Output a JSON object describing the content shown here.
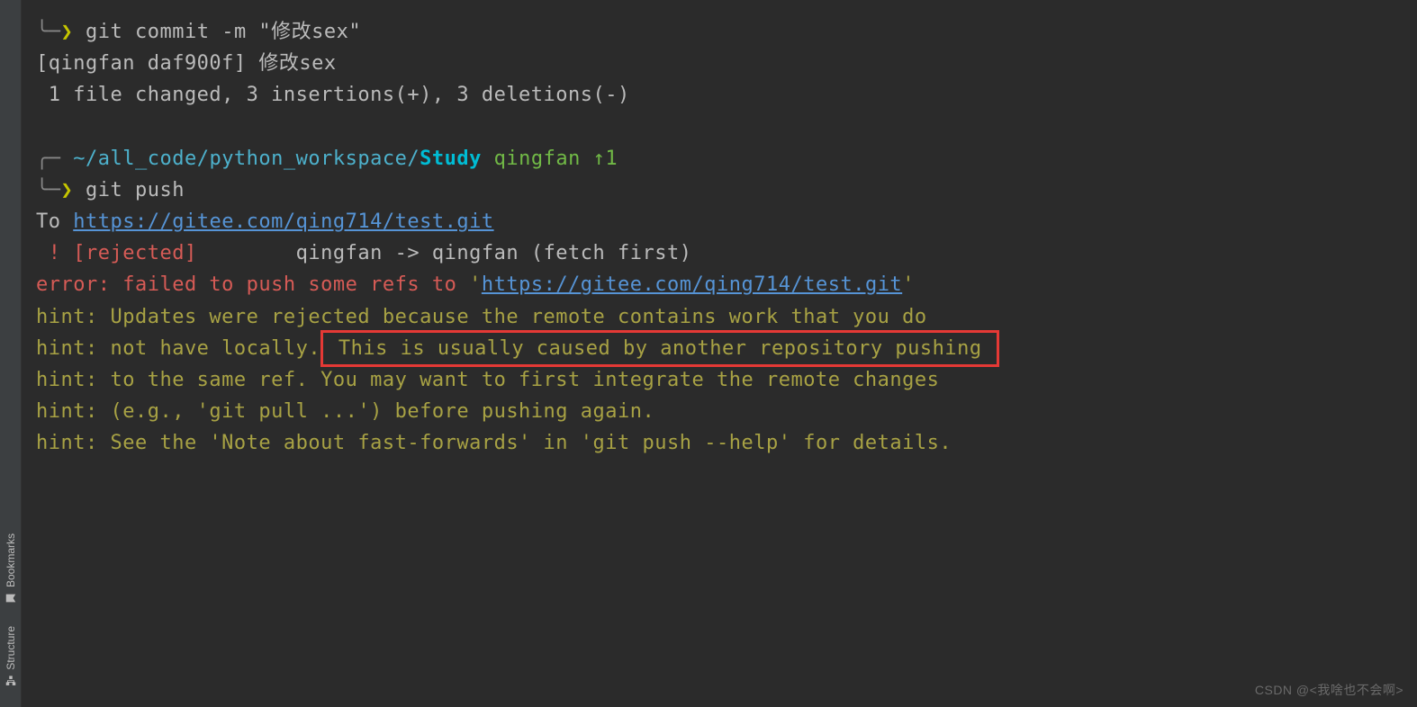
{
  "sidebar": {
    "tabs": [
      {
        "label": "Bookmarks"
      },
      {
        "label": "Structure"
      }
    ]
  },
  "terminal": {
    "line1_cmd": "git commit -m \"修改sex\"",
    "line2": "[qingfan daf900f] 修改sex",
    "line3": " 1 file changed, 3 insertions(+), 3 deletions(-)",
    "prompt_path": "~/all_code/python_workspace/",
    "prompt_project": "Study",
    "prompt_branch": " qingfan ",
    "prompt_status": "↑1",
    "line5_cmd": "git push",
    "push_to": "To ",
    "push_url1": "https://gitee.com/qing714/test.git",
    "rejected_bang": " ! ",
    "rejected_label": "[rejected]",
    "rejected_rest": "        qingfan -> qingfan (fetch first)",
    "error_prefix": "error: failed to push some refs to ",
    "error_quote1": "'",
    "error_url": "https://gitee.com/qing714/test.git",
    "error_quote2": "'",
    "hint1": "hint: Updates were rejected because the remote contains work that you do",
    "hint2a": "hint: not have locally.",
    "hint2b": " This is usually caused by another repository pushing ",
    "hint3": "hint: to the same ref. You may want to first integrate the remote changes",
    "hint4": "hint: (e.g., 'git pull ...') before pushing again.",
    "hint5": "hint: See the 'Note about fast-forwards' in 'git push --help' for details."
  },
  "watermark": "CSDN @<我啥也不会啊>"
}
